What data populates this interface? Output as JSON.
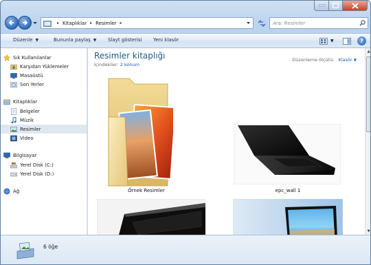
{
  "window": {
    "caption_buttons": {
      "minimize": "minimize",
      "maximize": "maximize",
      "close": "close"
    }
  },
  "navigation": {
    "breadcrumbs": [
      "Kitaplıklar",
      "Resimler"
    ],
    "search_placeholder": "Ara: Resimler"
  },
  "toolbar": {
    "organize_label": "Düzenle",
    "share_label": "Bununla paylaş",
    "slideshow_label": "Slayt gösterisi",
    "new_folder_label": "Yeni klasör"
  },
  "nav_pane": {
    "favorites": {
      "header": "Sık Kullanılanlar",
      "items": [
        "Karşıdan Yüklemeler",
        "Masaüstü",
        "Son Yerler"
      ]
    },
    "libraries": {
      "header": "Kitaplıklar",
      "items": [
        "Belgeler",
        "Müzik",
        "Resimler",
        "Video"
      ],
      "selected": "Resimler"
    },
    "computer": {
      "header": "Bilgisayar",
      "items": [
        "Yerel Disk (C:)",
        "Yerel Disk (D:)"
      ]
    },
    "network": {
      "header": "Ağ"
    }
  },
  "main": {
    "title": "Resimler kitaplığı",
    "includes_label": "İçindekiler:",
    "includes_link": "2 konum",
    "arrange_label": "Düzenleme ölçütü:",
    "arrange_value": "Klasör",
    "items": [
      {
        "label": "Örnek Resimler",
        "kind": "folder"
      },
      {
        "label": "epc_wall 1",
        "kind": "image"
      },
      {
        "label": "",
        "kind": "image"
      },
      {
        "label": "",
        "kind": "image"
      }
    ]
  },
  "details": {
    "count_text": "6 öğe"
  },
  "colors": {
    "accent": "#1e5a8a",
    "link": "#1561b0",
    "selected_row": "#dfe8f1",
    "chrome": "#c9dcf1"
  }
}
